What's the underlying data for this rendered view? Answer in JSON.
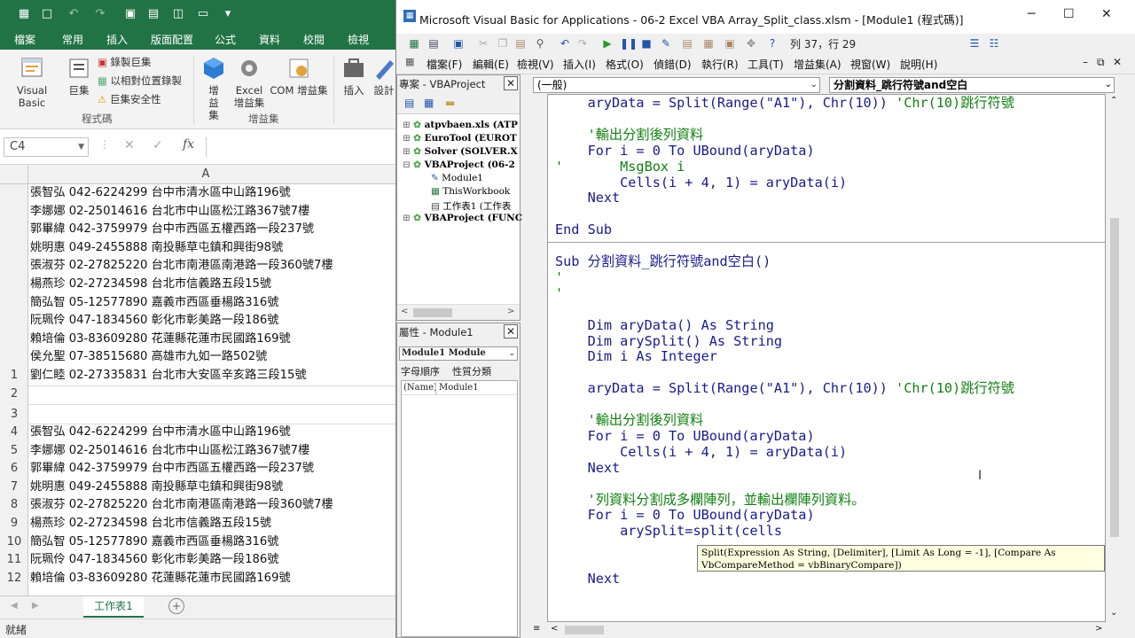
{
  "excel": {
    "tabs": [
      "檔案",
      "常用",
      "插入",
      "版面配置",
      "公式",
      "資料",
      "校閱",
      "檢視"
    ],
    "ribbon": {
      "visual_basic": "Visual Basic",
      "macros": "巨集",
      "record_macro": "錄製巨集",
      "relative_ref": "以相對位置錄製",
      "macro_security": "巨集安全性",
      "group_code": "程式碼",
      "addins": "增益集",
      "excel_addins": "Excel 增益集",
      "com_addins": "COM 增益集",
      "group_addins": "增益集",
      "insert": "插入",
      "design": "設計"
    },
    "name_box": "C4",
    "column_a": "A",
    "rows_top": [
      "張智弘 042-6224299 台中市清水區中山路196號",
      "李娜娜 02-25014616 台北市中山區松江路367號7樓",
      "郭畢緯 042-3759979 台中市西區五權西路一段237號",
      "姚明惠 049-2455888 南投縣草屯鎮和興街98號",
      "張淑芬 02-27825220 台北市南港區南港路一段360號7樓",
      "楊燕珍 02-27234598 台北市信義路五段15號",
      "簡弘智 05-12577890 嘉義市西區垂楊路316號",
      "阮珮伶 047-1834560 彰化市彰美路一段186號",
      "賴培倫 03-83609280 花蓮縣花蓮市民國路169號",
      "侯允聖 07-38515680 高雄市九如一路502號",
      "劉仁睦 02-27335831 台北市大安區辛亥路三段15號"
    ],
    "row_numbers_top": [
      "1",
      "2",
      "3"
    ],
    "rows_bottom": [
      {
        "n": "4",
        "t": "張智弘 042-6224299 台中市清水區中山路196號"
      },
      {
        "n": "5",
        "t": "李娜娜 02-25014616 台北市中山區松江路367號7樓"
      },
      {
        "n": "6",
        "t": "郭畢緯 042-3759979 台中市西區五權西路一段237號"
      },
      {
        "n": "7",
        "t": "姚明惠 049-2455888 南投縣草屯鎮和興街98號"
      },
      {
        "n": "8",
        "t": "張淑芬 02-27825220 台北市南港區南港路一段360號7樓"
      },
      {
        "n": "9",
        "t": "楊燕珍 02-27234598 台北市信義路五段15號"
      },
      {
        "n": "10",
        "t": "簡弘智 05-12577890 嘉義市西區垂楊路316號"
      },
      {
        "n": "11",
        "t": "阮珮伶 047-1834560 彰化市彰美路一段186號"
      },
      {
        "n": "12",
        "t": "賴培倫 03-83609280 花蓮縣花蓮市民國路169號"
      }
    ],
    "sheet_tab": "工作表1",
    "status": "就緒"
  },
  "vbe": {
    "title": "Microsoft Visual Basic for Applications - 06-2 Excel VBA Array_Split_class.xlsm - [Module1 (程式碼)]",
    "position": "列 37，行 29",
    "menu": [
      "檔案(F)",
      "編輯(E)",
      "檢視(V)",
      "插入(I)",
      "格式(O)",
      "偵錯(D)",
      "執行(R)",
      "工具(T)",
      "增益集(A)",
      "視窗(W)",
      "說明(H)"
    ],
    "project_title": "專案 - VBAProject",
    "tree": [
      "atpvbaen.xls (ATP",
      "EuroTool (EUROT",
      "Solver (SOLVER.X",
      "VBAProject (06-2",
      "VBAProject (FUNC"
    ],
    "tree_children": [
      "Module1",
      "ThisWorkbook",
      "工作表1 (工作表"
    ],
    "props_title": "屬性 - Module1",
    "props_object": "Module1 Module",
    "props_tab_alpha": "字母順序",
    "props_tab_cat": "性質分類",
    "props_name_key": "(Name)",
    "props_name_val": "Module1",
    "object_combo": "(一般)",
    "proc_combo": "分割資料_跳行符號and空白",
    "code_lines": [
      {
        "t": "    aryData = Split(Range(\"A1\"), Chr(10)) ",
        "c": "'Chr(10)跳行符號"
      },
      {
        "t": "",
        "c": ""
      },
      {
        "t": "    ",
        "c": "'輸出分割後列資料"
      },
      {
        "t": "    For i = 0 To UBound(aryData)",
        "c": ""
      },
      {
        "t": "",
        "c": "'       MsgBox i"
      },
      {
        "t": "        Cells(i + 4, 1) = aryData(i)",
        "c": ""
      },
      {
        "t": "    Next",
        "c": ""
      },
      {
        "t": "",
        "c": ""
      },
      {
        "t": "End Sub",
        "c": ""
      },
      {
        "t": "",
        "c": ""
      },
      {
        "t": "Sub 分割資料_跳行符號and空白()",
        "c": ""
      },
      {
        "t": "",
        "c": "'"
      },
      {
        "t": "",
        "c": "'"
      },
      {
        "t": "",
        "c": ""
      },
      {
        "t": "    Dim aryData() As String",
        "c": ""
      },
      {
        "t": "    Dim arySplit() As String",
        "c": ""
      },
      {
        "t": "    Dim i As Integer",
        "c": ""
      },
      {
        "t": "",
        "c": ""
      },
      {
        "t": "    aryData = Split(Range(\"A1\"), Chr(10)) ",
        "c": "'Chr(10)跳行符號"
      },
      {
        "t": "",
        "c": ""
      },
      {
        "t": "    ",
        "c": "'輸出分割後列資料"
      },
      {
        "t": "    For i = 0 To UBound(aryData)",
        "c": ""
      },
      {
        "t": "        Cells(i + 4, 1) = aryData(i)",
        "c": ""
      },
      {
        "t": "    Next",
        "c": ""
      },
      {
        "t": "",
        "c": ""
      },
      {
        "t": "    ",
        "c": "'列資料分割成多欄陣列，並輸出欄陣列資料。"
      },
      {
        "t": "    For i = 0 To UBound(aryData)",
        "c": ""
      },
      {
        "t": "        arySplit=split(cells",
        "c": ""
      },
      {
        "t": "",
        "c": ""
      },
      {
        "t": "",
        "c": ""
      },
      {
        "t": "    Next",
        "c": ""
      }
    ],
    "tooltip": "Split(Expression As String, [Delimiter], [Limit As Long = -1], [Compare As VbCompareMethod = vbBinaryCompare])"
  }
}
